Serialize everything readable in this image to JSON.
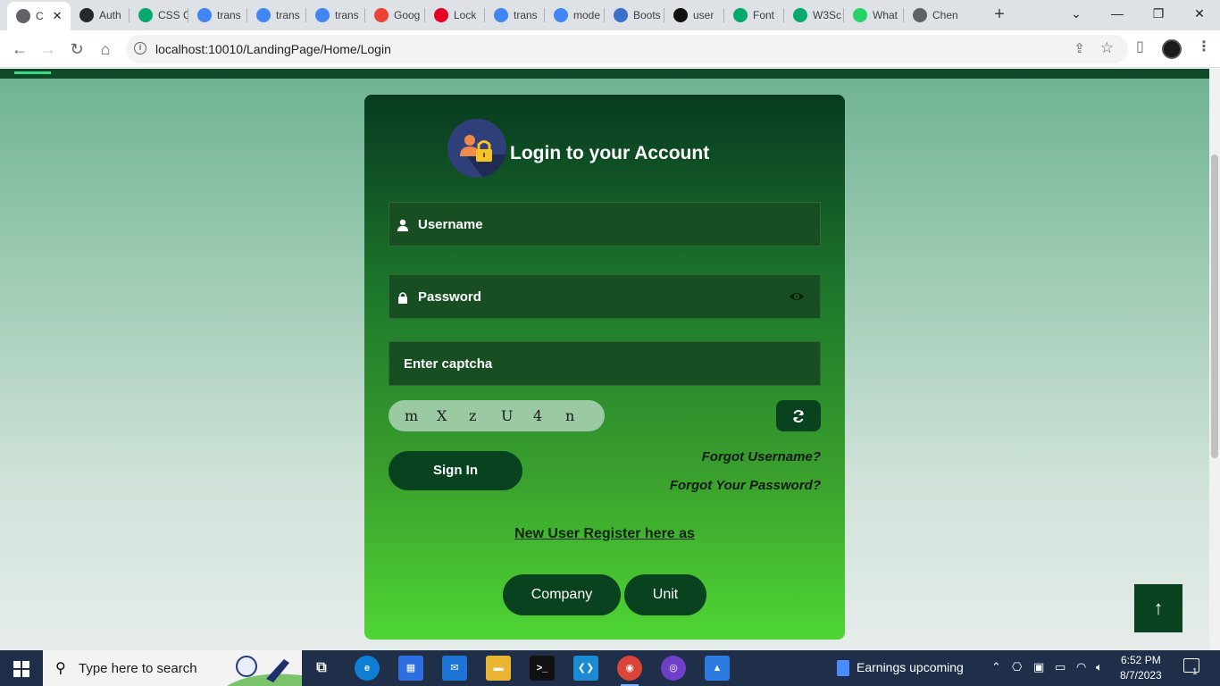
{
  "browser": {
    "tabs": [
      {
        "title": "C",
        "favicon": "globe-icon",
        "color": "#5f6368",
        "active": true
      },
      {
        "title": "Auth",
        "favicon": "github-icon",
        "color": "#24292f"
      },
      {
        "title": "CSS C",
        "favicon": "w3schools-icon",
        "color": "#04aa6d"
      },
      {
        "title": "trans",
        "favicon": "google-icon",
        "color": "#4285f4"
      },
      {
        "title": "trans",
        "favicon": "google-icon",
        "color": "#4285f4"
      },
      {
        "title": "trans",
        "favicon": "google-icon",
        "color": "#4285f4"
      },
      {
        "title": "Goog",
        "favicon": "google-lens-icon",
        "color": "#ea4335"
      },
      {
        "title": "Lock",
        "favicon": "pinterest-icon",
        "color": "#e60023"
      },
      {
        "title": "trans",
        "favicon": "google-icon",
        "color": "#4285f4"
      },
      {
        "title": "mode",
        "favicon": "google-icon",
        "color": "#4285f4"
      },
      {
        "title": "Boots",
        "favicon": "mdb-icon",
        "color": "#3b71ca"
      },
      {
        "title": "user",
        "favicon": "dots-icon",
        "color": "#111111"
      },
      {
        "title": "Font",
        "favicon": "w3schools-icon",
        "color": "#04aa6d"
      },
      {
        "title": "W3Sc",
        "favicon": "w3schools-icon",
        "color": "#04aa6d"
      },
      {
        "title": "What",
        "favicon": "whatsapp-icon",
        "color": "#25d366"
      },
      {
        "title": "Chen",
        "favicon": "globe-icon",
        "color": "#5f6368"
      }
    ],
    "url": "localhost:10010/LandingPage/Home/Login"
  },
  "login": {
    "title": "Login to your Account",
    "username_placeholder": "Username",
    "password_placeholder": "Password",
    "captcha_placeholder": "Enter captcha",
    "captcha_chars": [
      "m",
      "X",
      "z",
      "U",
      "4",
      "n"
    ],
    "signin_label": "Sign In",
    "forgot_username": "Forgot Username?",
    "forgot_password": "Forgot Your Password?",
    "register_text": "New User Register here as",
    "company_label": "Company",
    "unit_label": "Unit"
  },
  "taskbar": {
    "search_placeholder": "Type here to search",
    "news": "Earnings upcoming",
    "time": "6:52 PM",
    "date": "8/7/2023",
    "notification_count": "1"
  },
  "colors": {
    "card_dark": "#073a20",
    "card_light": "#4fd634",
    "button": "#08421f"
  }
}
